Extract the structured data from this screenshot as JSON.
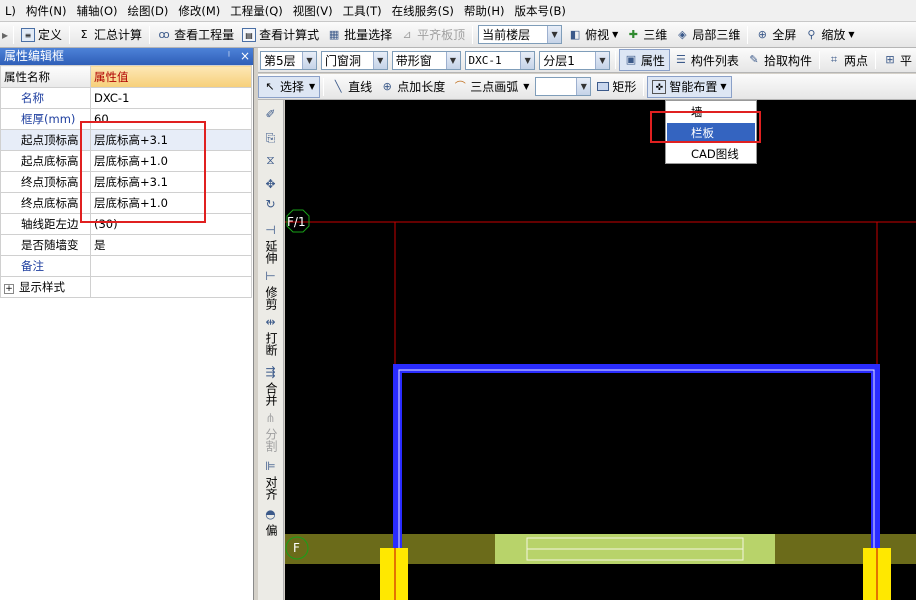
{
  "menubar": {
    "items": [
      "L)",
      "构件(N)",
      "辅轴(O)",
      "绘图(D)",
      "修改(M)",
      "工程量(Q)",
      "视图(V)",
      "工具(T)",
      "在线服务(S)",
      "帮助(H)",
      "版本号(B)"
    ]
  },
  "toolbar1": {
    "define": "定义",
    "sum": "汇总计算",
    "view_qty": "查看工程量",
    "view_formula": "查看计算式",
    "batch_select": "批量选择",
    "level_slab": "平齐板顶",
    "floor_mode": "当前楼层",
    "top_view": "俯视",
    "three_d": "三维",
    "local_3d": "局部三维",
    "fullscreen": "全屏",
    "zoom": "缩放"
  },
  "toolbar2": {
    "floor": "第5层",
    "category": "门窗洞",
    "type": "带形窗",
    "component": "DXC-1",
    "layer": "分层1",
    "property": "属性",
    "component_list": "构件列表",
    "pick": "拾取构件",
    "two_point": "两点",
    "flat": "平"
  },
  "toolbar3": {
    "select": "选择",
    "line": "直线",
    "point_length": "点加长度",
    "three_arc": "三点画弧",
    "rect": "矩形",
    "smart": "智能布置"
  },
  "dropdown": {
    "items": [
      "墙",
      "栏板",
      "CAD图线"
    ],
    "selected": "栏板"
  },
  "panel": {
    "title": "属性编辑框",
    "pin": "ᛌ",
    "close": "×",
    "col_name": "属性名称",
    "col_value": "属性值",
    "rows": [
      {
        "name": "名称",
        "value": "DXC-1"
      },
      {
        "name": "框厚(mm)",
        "value": "60"
      },
      {
        "name": "起点顶标高",
        "value": "层底标高+3.1"
      },
      {
        "name": "起点底标高",
        "value": "层底标高+1.0"
      },
      {
        "name": "终点顶标高",
        "value": "层底标高+3.1"
      },
      {
        "name": "终点底标高",
        "value": "层底标高+1.0"
      },
      {
        "name": "轴线距左边",
        "value": "(30)"
      },
      {
        "name": "是否随墙变",
        "value": "是"
      },
      {
        "name": "备注",
        "value": ""
      },
      {
        "name": "显示样式",
        "value": ""
      }
    ]
  },
  "sidebar": {
    "items": [
      "延伸",
      "修剪",
      "打断",
      "合并",
      "分割",
      "对齐",
      "偏"
    ]
  },
  "canvas": {
    "axis_f1": "F/1",
    "axis_f": "F"
  },
  "colors": {
    "wall_blue": "#2a2cff",
    "beam_olive": "#6b6b1a",
    "slab_green": "#b8d36a",
    "col_yellow": "#ffe800",
    "axis_red": "#c80000",
    "green_marker": "#19a019",
    "accent_red": "#e02020"
  }
}
